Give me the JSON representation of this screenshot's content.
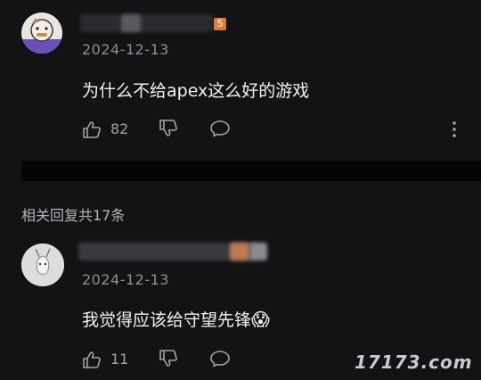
{
  "comments": [
    {
      "date": "2024-12-13",
      "badge": "5",
      "text": "为什么不给apex这么好的游戏",
      "likes": "82"
    },
    {
      "date": "2024-12-13",
      "text": "我觉得应该给守望先锋",
      "emoji": "😱",
      "likes": "11"
    }
  ],
  "replies_label": "相关回复共17条",
  "watermark": "17173.com",
  "colors": {
    "background": "#131316",
    "divider": "#050506",
    "badge": "#e07a3a"
  },
  "icons": {
    "like": "thumbs-up-icon",
    "dislike": "thumbs-down-icon",
    "reply": "speech-bubble-icon",
    "more": "vertical-dots-icon"
  }
}
